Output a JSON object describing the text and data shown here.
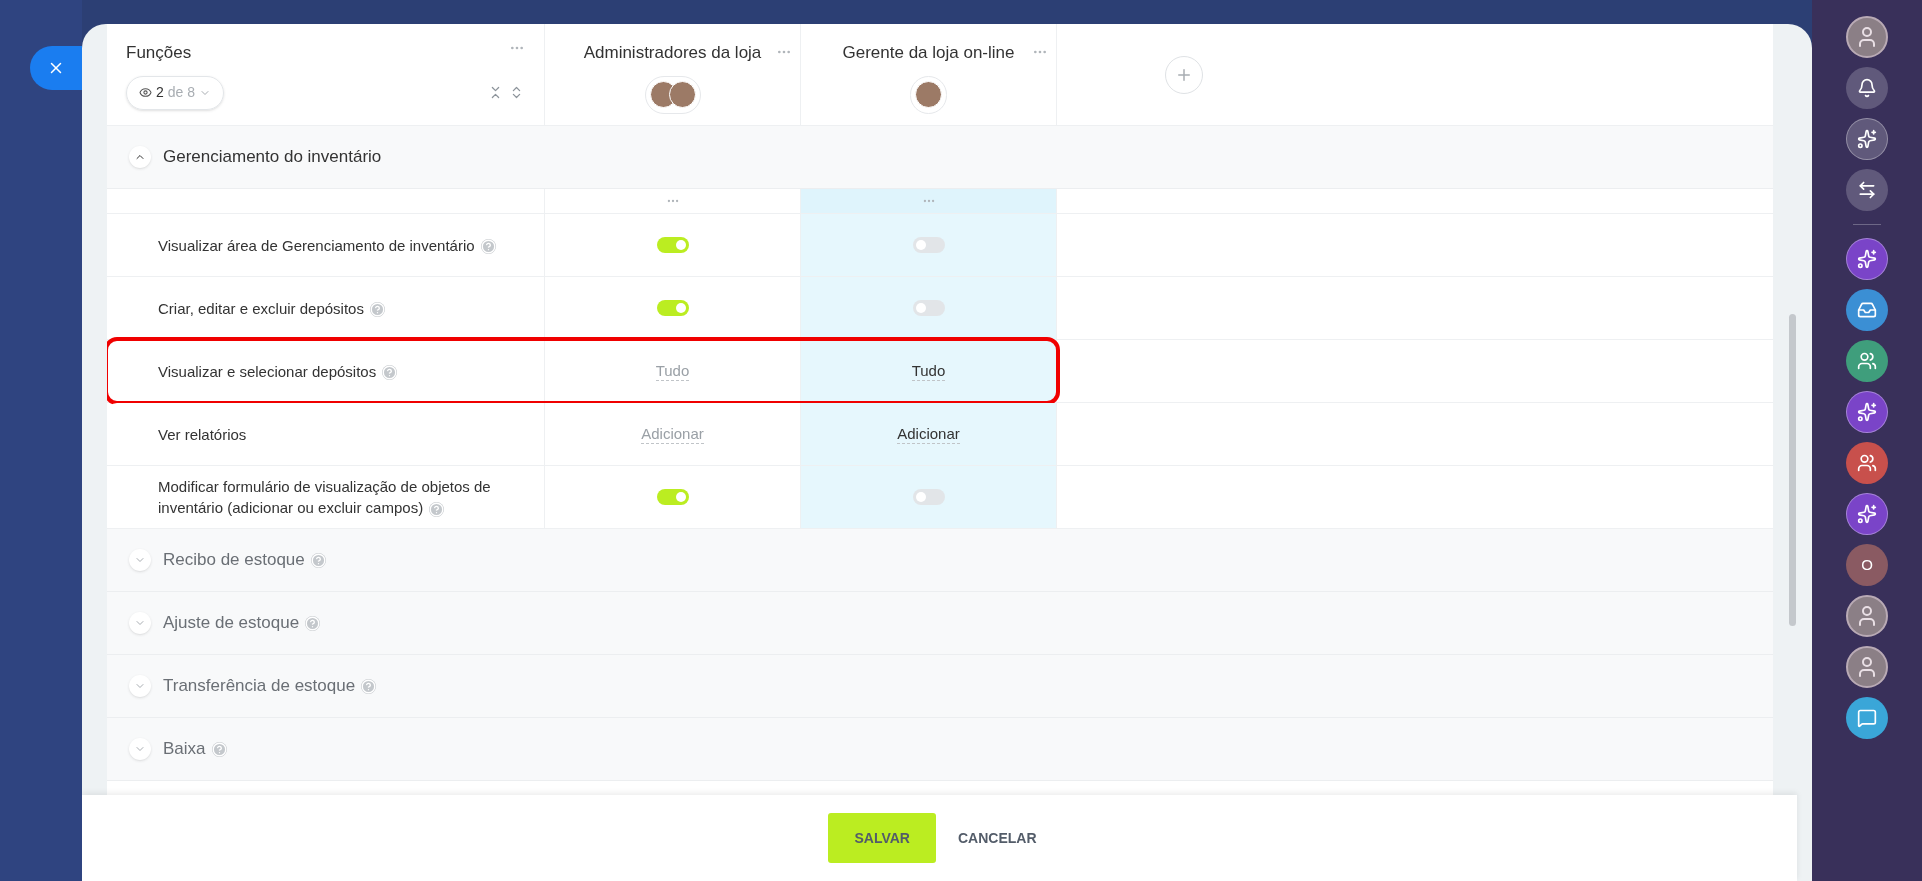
{
  "roles_header": {
    "title": "Funções",
    "filter": {
      "shown": "2",
      "total": "de 8"
    }
  },
  "columns": [
    {
      "title": "Administradores da loja",
      "selected": false,
      "avatars": [
        {
          "kind": "photo"
        },
        {
          "kind": "photo"
        }
      ]
    },
    {
      "title": "Gerente da loja on-line",
      "selected": true,
      "avatars": [
        {
          "kind": "photo"
        }
      ]
    }
  ],
  "sections": [
    {
      "title": "Gerenciamento do inventário",
      "expanded": true,
      "help": false,
      "rows": [
        {
          "label": "Visualizar área de Gerenciamento de inventário",
          "help": true,
          "highlighted": false,
          "cells": [
            {
              "kind": "toggle",
              "on": true
            },
            {
              "kind": "toggle",
              "on": false
            }
          ]
        },
        {
          "label": "Criar, editar e excluir depósitos",
          "help": true,
          "highlighted": false,
          "cells": [
            {
              "kind": "toggle",
              "on": true
            },
            {
              "kind": "toggle",
              "on": false
            }
          ]
        },
        {
          "label": "Visualizar e selecionar depósitos",
          "help": true,
          "highlighted": true,
          "cells": [
            {
              "kind": "link",
              "text": "Tudo"
            },
            {
              "kind": "link",
              "text": "Tudo"
            }
          ]
        },
        {
          "label": "Ver relatórios",
          "help": false,
          "highlighted": false,
          "cells": [
            {
              "kind": "link",
              "text": "Adicionar"
            },
            {
              "kind": "link",
              "text": "Adicionar"
            }
          ]
        },
        {
          "label": "Modificar formulário de visualização de objetos de inventário (adicionar ou excluir campos)",
          "help": true,
          "highlighted": false,
          "cells": [
            {
              "kind": "toggle",
              "on": true
            },
            {
              "kind": "toggle",
              "on": false
            }
          ]
        }
      ]
    },
    {
      "title": "Recibo de estoque",
      "expanded": false,
      "help": true
    },
    {
      "title": "Ajuste de estoque",
      "expanded": false,
      "help": true
    },
    {
      "title": "Transferência de estoque",
      "expanded": false,
      "help": true
    },
    {
      "title": "Baixa",
      "expanded": false,
      "help": true
    }
  ],
  "footer_buttons": [
    {
      "label": "SALVAR",
      "kind": "primary"
    },
    {
      "label": "CANCELAR",
      "kind": "plain"
    }
  ],
  "sidebar": [
    {
      "kind": "avatar"
    },
    {
      "kind": "bell"
    },
    {
      "kind": "copilot"
    },
    {
      "kind": "exchange"
    },
    {
      "kind": "divider"
    },
    {
      "kind": "copilot",
      "color": "#7a44c8"
    },
    {
      "kind": "inbox",
      "color": "#3b8fd4"
    },
    {
      "kind": "group",
      "color": "#3f9e7c"
    },
    {
      "kind": "copilot",
      "color": "#7a44c8"
    },
    {
      "kind": "group",
      "color": "#c8504c"
    },
    {
      "kind": "copilot",
      "color": "#7a44c8"
    },
    {
      "kind": "letter",
      "text": "O",
      "color": "#8a5a62"
    },
    {
      "kind": "avatar"
    },
    {
      "kind": "avatar"
    },
    {
      "kind": "chat",
      "color": "#3aa6d8"
    }
  ]
}
